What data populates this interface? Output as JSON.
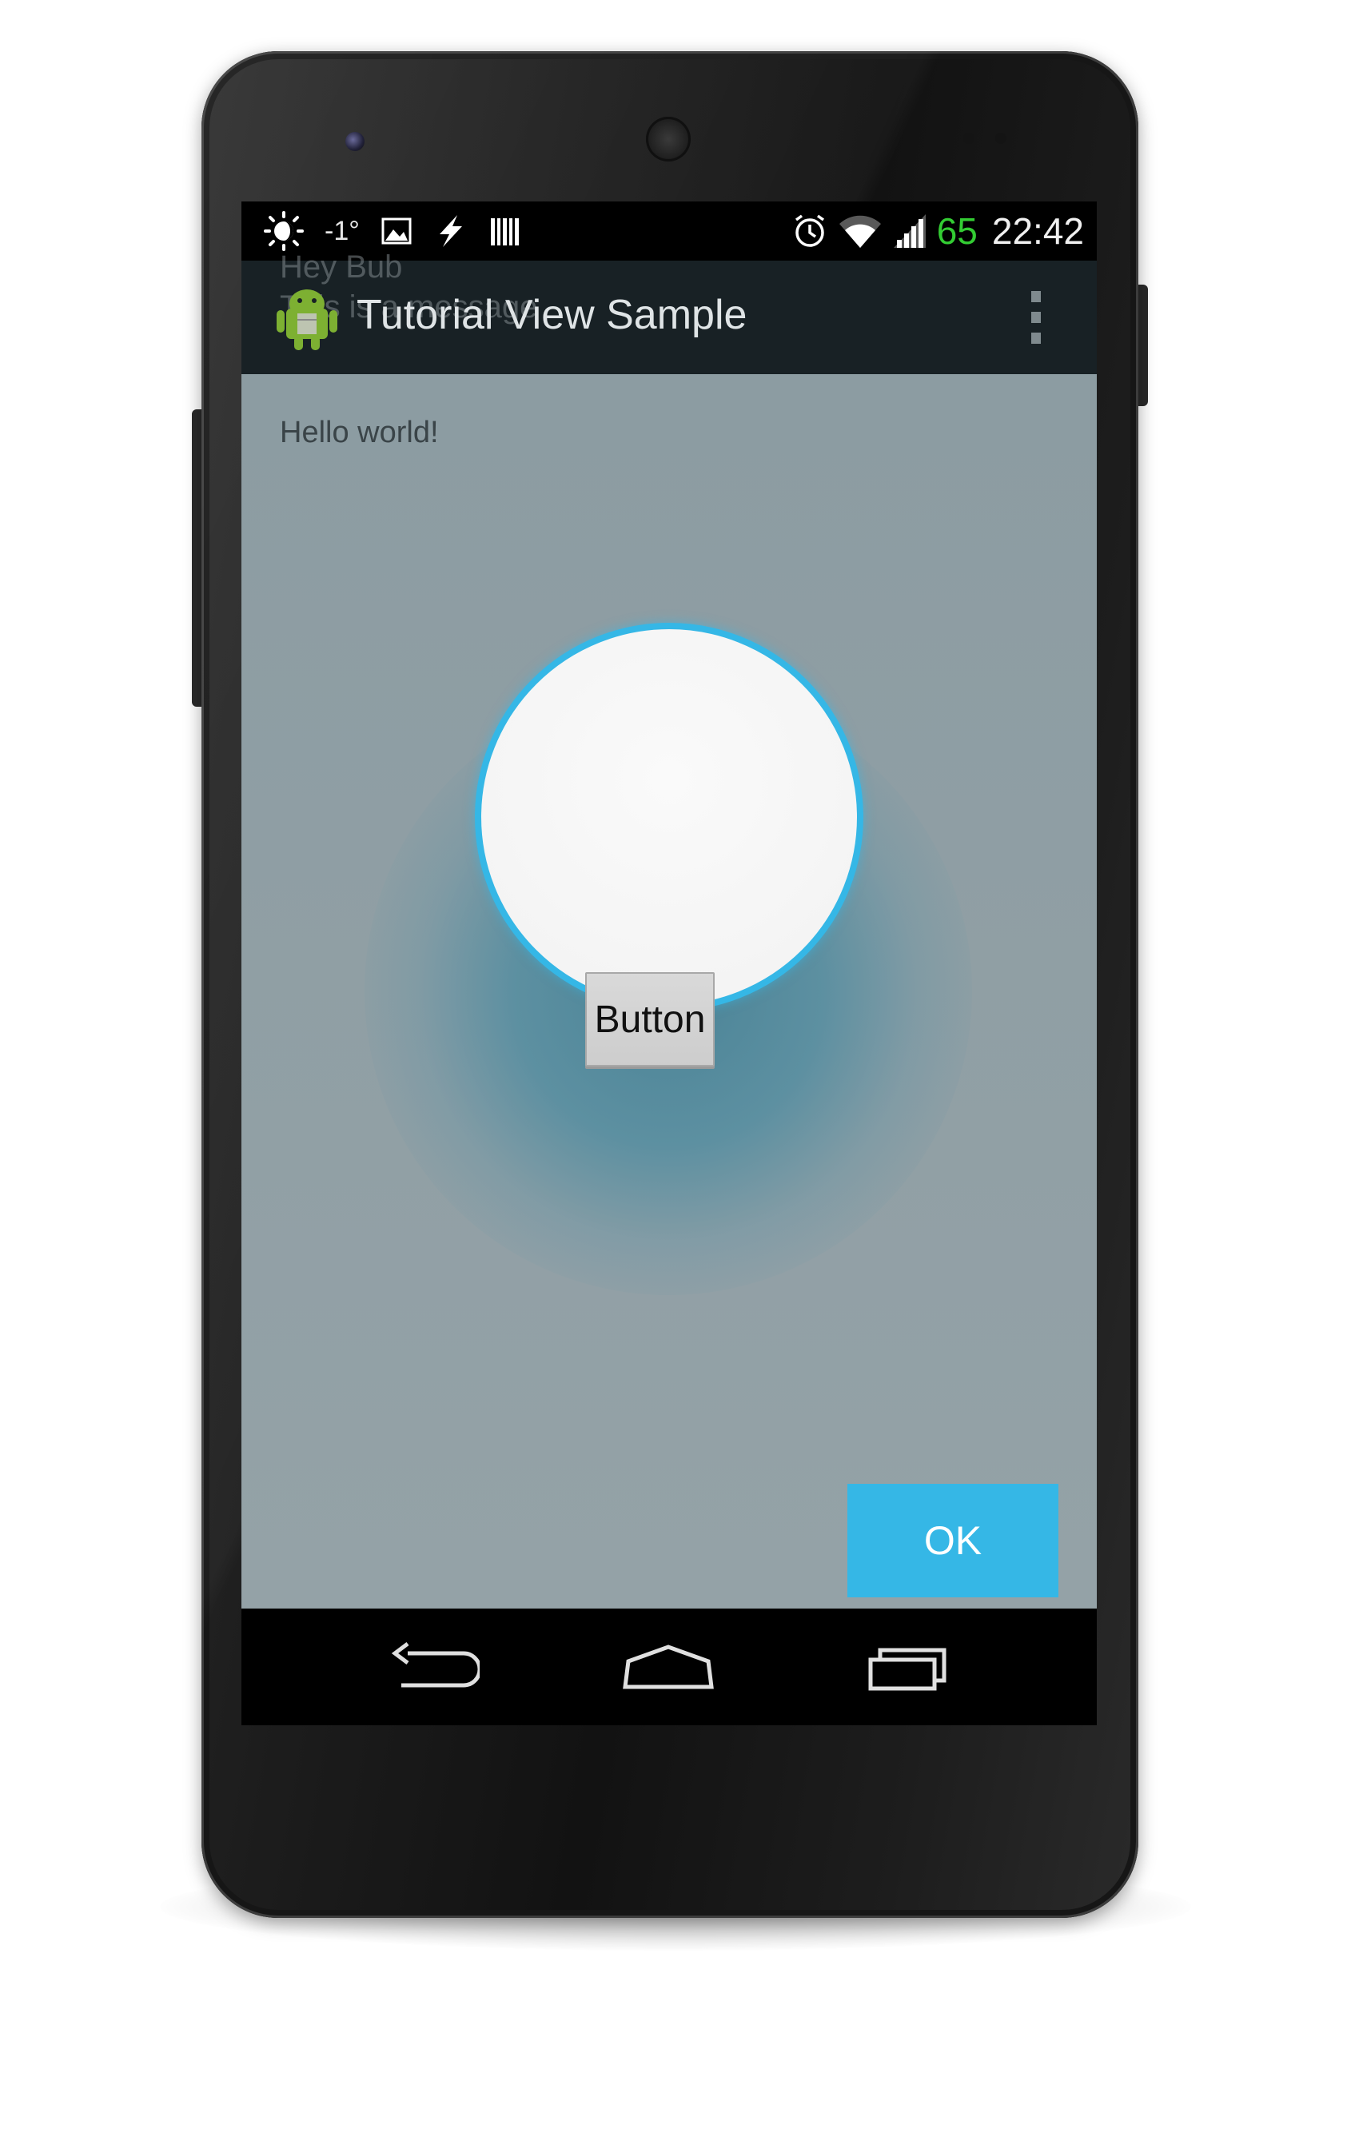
{
  "status_bar": {
    "temperature": "-1°",
    "battery_level": "65",
    "time": "22:42",
    "battery_color": "#33cc33",
    "icons_left": [
      "weather-sun-moon-icon",
      "image-icon",
      "flash-icon",
      "barcode-icon"
    ],
    "icons_right": [
      "alarm-icon",
      "wifi-icon",
      "cell-signal-icon"
    ]
  },
  "action_bar": {
    "title": "Tutorial View Sample",
    "notification_ghost_line1": "Hey Bub",
    "notification_ghost_line2": "This is a message",
    "background": "#182125"
  },
  "content": {
    "hello_text": "Hello world!",
    "button_label": "Button",
    "ok_label": "OK",
    "accent_color": "#35b7e6",
    "overlay_color": "#8f9ea4"
  },
  "nav_bar": {
    "buttons": [
      "back-icon",
      "home-icon",
      "recent-apps-icon"
    ]
  }
}
